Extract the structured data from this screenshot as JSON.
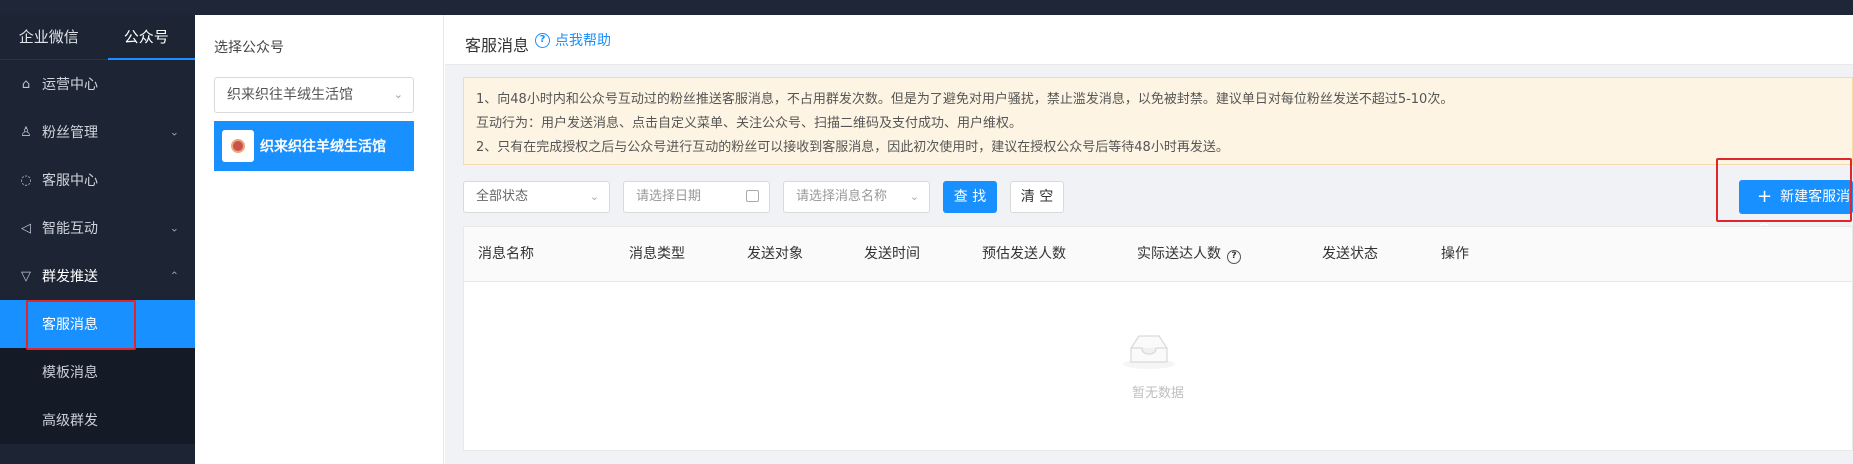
{
  "sidebar": {
    "tabs": [
      {
        "label": "企业微信"
      },
      {
        "label": "公众号"
      }
    ],
    "items": [
      {
        "label": "运营中心",
        "icon": "home-icon"
      },
      {
        "label": "粉丝管理",
        "icon": "users-icon"
      },
      {
        "label": "客服中心",
        "icon": "chat-icon"
      },
      {
        "label": "智能互动",
        "icon": "megaphone-icon"
      },
      {
        "label": "群发推送",
        "icon": "funnel-icon"
      }
    ],
    "sub_items": [
      {
        "label": "客服消息"
      },
      {
        "label": "模板消息"
      },
      {
        "label": "高级群发"
      }
    ]
  },
  "account_panel": {
    "title": "选择公众号",
    "select_value": "织来织往羊绒生活馆",
    "selected_account": "织来织往羊绒生活馆"
  },
  "header": {
    "title": "客服消息",
    "help_label": "点我帮助"
  },
  "notice": {
    "lines": [
      "1、向48小时内和公众号互动过的粉丝推送客服消息，不占用群发次数。但是为了避免对用户骚扰，禁止滥发消息，以免被封禁。建议单日对每位粉丝发送不超过5-10次。",
      "互动行为：用户发送消息、点击自定义菜单、关注公众号、扫描二维码及支付成功、用户维权。",
      "2、只有在完成授权之后与公众号进行互动的粉丝可以接收到客服消息，因此初次使用时，建议在授权公众号后等待48小时再发送。"
    ]
  },
  "filters": {
    "status_value": "全部状态",
    "date_placeholder": "请选择日期",
    "name_placeholder": "请选择消息名称",
    "search_label": "查 找",
    "clear_label": "清 空"
  },
  "new_button_label": "新建客服消息",
  "table": {
    "columns": [
      "消息名称",
      "消息类型",
      "发送对象",
      "发送时间",
      "预估发送人数",
      "实际送达人数",
      "发送状态",
      "操作"
    ],
    "empty_text": "暂无数据"
  },
  "colors": {
    "primary": "#1890ff",
    "sidebar_bg": "#1d2433",
    "highlight_box": "#e0262b",
    "notice_bg": "#fdf4e3"
  }
}
